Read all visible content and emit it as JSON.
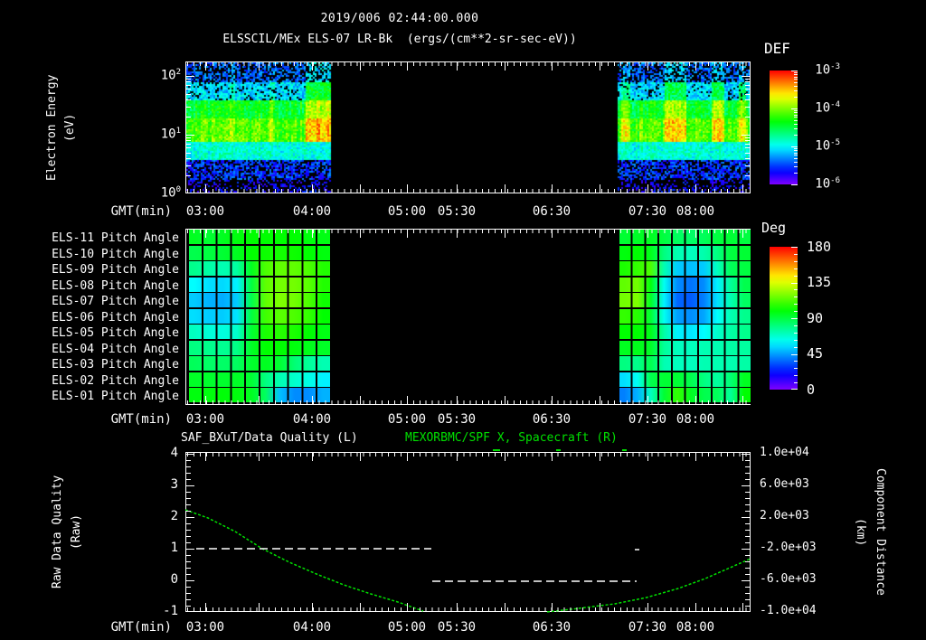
{
  "header": {
    "timestamp": "2019/006 02:44:00.000",
    "title": "ELSSCIL/MEx ELS-07 LR-Bk  (ergs/(cm**2-sr-sec-eV))"
  },
  "colors": {
    "fg": "#ffffff",
    "bg": "#000000",
    "green": "#00e000"
  },
  "time_axis": {
    "label": "GMT(min)",
    "ticks": [
      {
        "t": "03:00",
        "x": 227
      },
      {
        "t": "04:00",
        "x": 345
      },
      {
        "t": "05:00",
        "x": 450
      },
      {
        "t": "05:30",
        "x": 505
      },
      {
        "t": "06:30",
        "x": 610
      },
      {
        "t": "07:30",
        "x": 716
      },
      {
        "t": "08:00",
        "x": 769
      }
    ],
    "major_ticks_x": [
      227,
      286,
      345,
      398,
      450,
      505,
      558,
      610,
      663,
      716,
      769,
      821
    ]
  },
  "chart_data": [
    {
      "type": "heatmap",
      "name": "electron-energy-spectrogram",
      "title": "ELSSCIL/MEx ELS-07 LR-Bk",
      "units": "ergs/(cm**2-sr-sec-eV)",
      "y_label_line1": "Electron Energy",
      "y_label_line2": "(eV)",
      "yscale": "log",
      "ylim": [
        1,
        300
      ],
      "y_ticks": [
        {
          "base": "10",
          "exp": "2",
          "y": 84
        },
        {
          "base": "10",
          "exp": "1",
          "y": 149
        },
        {
          "base": "10",
          "exp": "0",
          "y": 214
        }
      ],
      "colorbar": {
        "title": "DEF",
        "scale": "log",
        "ticks": [
          {
            "base": "10",
            "exp": "-3",
            "y": 78
          },
          {
            "base": "10",
            "exp": "-4",
            "y": 120
          },
          {
            "base": "10",
            "exp": "-5",
            "y": 162
          },
          {
            "base": "10",
            "exp": "-6",
            "y": 204
          }
        ]
      },
      "segments": [
        {
          "x1": 206,
          "x2": 365,
          "streaks": [
            [
              338,
              364,
              0.22
            ],
            [
              253,
              258,
              0.08
            ],
            [
              297,
              302,
              0.08
            ]
          ]
        },
        {
          "x1": 683,
          "x2": 829,
          "streaks": [
            [
              686,
              695,
              0.12
            ],
            [
              734,
              758,
              0.18
            ],
            [
              786,
              800,
              0.18
            ],
            [
              816,
              824,
              0.15
            ]
          ]
        }
      ],
      "data_gap_x": [
        365,
        683
      ]
    },
    {
      "type": "heatmap",
      "name": "pitch-angle-panel",
      "row_labels": [
        "ELS-11 Pitch Angle",
        "ELS-10 Pitch Angle",
        "ELS-09 Pitch Angle",
        "ELS-08 Pitch Angle",
        "ELS-07 Pitch Angle",
        "ELS-06 Pitch Angle",
        "ELS-05 Pitch Angle",
        "ELS-04 Pitch Angle",
        "ELS-03 Pitch Angle",
        "ELS-02 Pitch Angle",
        "ELS-01 Pitch Angle"
      ],
      "colorbar": {
        "title": "Deg",
        "ticks": [
          {
            "v": "180",
            "y": 273
          },
          {
            "v": "135",
            "y": 312
          },
          {
            "v": "90",
            "y": 352
          },
          {
            "v": "45",
            "y": 391
          },
          {
            "v": "0",
            "y": 431
          }
        ],
        "range": [
          0,
          180
        ]
      },
      "segments": [
        {
          "x1": 207,
          "x2": 365,
          "deg": [
            [
              95,
              92,
              95,
              98,
              100,
              100,
              100,
              100,
              98,
              97
            ],
            [
              88,
              90,
              92,
              95,
              100,
              102,
              103,
              102,
              100,
              98
            ],
            [
              78,
              74,
              72,
              75,
              95,
              112,
              115,
              115,
              112,
              105
            ],
            [
              60,
              55,
              54,
              58,
              90,
              115,
              118,
              118,
              114,
              105
            ],
            [
              52,
              48,
              47,
              52,
              88,
              115,
              120,
              118,
              112,
              102
            ],
            [
              55,
              52,
              52,
              56,
              90,
              110,
              114,
              112,
              108,
              100
            ],
            [
              70,
              66,
              65,
              68,
              92,
              104,
              106,
              104,
              100,
              97
            ],
            [
              80,
              78,
              77,
              79,
              94,
              100,
              100,
              98,
              96,
              94
            ],
            [
              86,
              84,
              84,
              85,
              93,
              95,
              92,
              82,
              76,
              72
            ],
            [
              94,
              93,
              93,
              94,
              92,
              80,
              72,
              68,
              64,
              58
            ],
            [
              98,
              98,
              99,
              98,
              95,
              85,
              50,
              42,
              42,
              48
            ]
          ]
        },
        {
          "x1": 683,
          "x2": 830,
          "deg": [
            [
              92,
              94,
              95,
              90,
              85,
              84,
              86,
              90,
              92,
              90
            ],
            [
              98,
              100,
              96,
              80,
              72,
              70,
              73,
              80,
              90,
              92
            ],
            [
              104,
              108,
              112,
              72,
              52,
              50,
              52,
              70,
              86,
              90
            ],
            [
              115,
              118,
              98,
              62,
              42,
              38,
              42,
              58,
              76,
              88
            ],
            [
              118,
              120,
              94,
              58,
              36,
              34,
              40,
              55,
              72,
              85
            ],
            [
              108,
              106,
              92,
              62,
              45,
              42,
              46,
              60,
              72,
              78
            ],
            [
              100,
              100,
              96,
              74,
              58,
              56,
              60,
              68,
              74,
              78
            ],
            [
              95,
              96,
              94,
              76,
              70,
              70,
              72,
              72,
              74,
              75
            ],
            [
              80,
              78,
              88,
              72,
              70,
              70,
              72,
              72,
              72,
              74
            ],
            [
              55,
              62,
              88,
              92,
              92,
              88,
              80,
              75,
              82,
              95
            ],
            [
              40,
              48,
              70,
              92,
              108,
              95,
              88,
              86,
              76,
              100
            ]
          ]
        }
      ]
    },
    {
      "type": "line",
      "name": "quality-and-distance-panel",
      "title_left": "SAF_BXuT/Data Quality (L)",
      "title_right": "MEXORBMC/SPF X, Spacecraft (R)",
      "y_label_left1": "Raw Data Quality",
      "y_label_left2": "(Raw)",
      "y_label_right1": "Component Distance",
      "y_label_right2": "(km)",
      "ylim_left": [
        -1,
        4
      ],
      "ylim_right": [
        -10000,
        10000
      ],
      "y_ticks_left": [
        {
          "v": "4",
          "y": 502
        },
        {
          "v": "3",
          "y": 537
        },
        {
          "v": "2",
          "y": 572
        },
        {
          "v": "1",
          "y": 607
        },
        {
          "v": "0",
          "y": 642
        },
        {
          "v": "-1",
          "y": 677
        }
      ],
      "y_ticks_right": [
        {
          "v": "1.0e+04",
          "y": 502
        },
        {
          "v": "6.0e+03",
          "y": 537
        },
        {
          "v": "2.0e+03",
          "y": 572
        },
        {
          "v": "-2.0e+03",
          "y": 607
        },
        {
          "v": "-6.0e+03",
          "y": 642
        },
        {
          "v": "-1.0e+04",
          "y": 677
        }
      ],
      "series": [
        {
          "name": "SAF_BXuT/Data Quality",
          "axis": "left",
          "style": "white-dashed",
          "values_note": "quality=1 early interval, quality=0 later interval"
        },
        {
          "name": "MEXORBMC/SPF X, Spacecraft",
          "axis": "right",
          "style": "green-dotted"
        }
      ],
      "quality_dashes": [
        {
          "y": 607,
          "x1": 217,
          "x2": 477
        },
        {
          "y": 643,
          "x1": 478,
          "x2": 704
        }
      ],
      "quality_dot": {
        "x": 704,
        "y": 608
      },
      "fill_dashes": [
        {
          "y": 498,
          "x1": 545,
          "x2": 553
        },
        {
          "y": 498,
          "x1": 615,
          "x2": 620
        },
        {
          "y": 498,
          "x1": 688,
          "x2": 693
        }
      ],
      "green_curve": [
        [
          [
            205,
            564
          ],
          [
            230,
            573
          ],
          [
            260,
            588
          ],
          [
            290,
            607
          ],
          [
            320,
            622
          ],
          [
            350,
            635
          ],
          [
            380,
            647
          ],
          [
            410,
            657
          ],
          [
            440,
            666
          ],
          [
            468,
            676
          ]
        ],
        [
          [
            605,
            677
          ],
          [
            640,
            673
          ],
          [
            680,
            668
          ],
          [
            715,
            661
          ],
          [
            750,
            651
          ],
          [
            780,
            640
          ],
          [
            805,
            629
          ],
          [
            830,
            618
          ]
        ]
      ]
    }
  ]
}
